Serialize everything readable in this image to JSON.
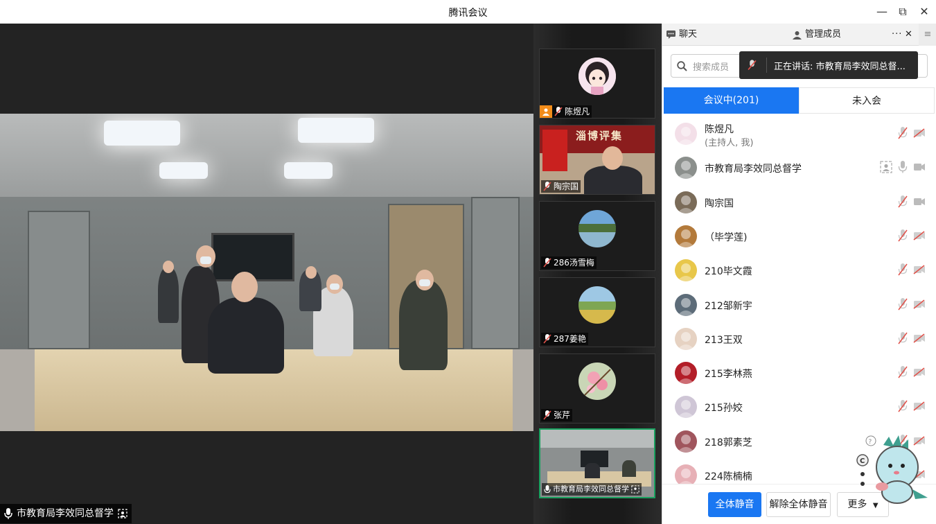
{
  "window": {
    "title": "腾讯会议",
    "minimize_glyph": "—",
    "restore_glyph": "⧉",
    "close_glyph": "✕"
  },
  "main_video": {
    "speaker_name": "市教育局李效同总督学"
  },
  "thumbnails": [
    {
      "name": "陈煜凡",
      "is_host": true
    },
    {
      "name": "陶宗国",
      "is_host": false,
      "banner_text": "淄博评集"
    },
    {
      "name": "286汤雪梅",
      "is_host": false
    },
    {
      "name": "287姜艳",
      "is_host": false
    },
    {
      "name": "张芹",
      "is_host": false
    },
    {
      "name": "市教育局李效同总督学",
      "is_host": false,
      "active": true
    }
  ],
  "panel": {
    "tab_chat": "聊天",
    "tab_manage": "管理成员",
    "more_glyph": "···",
    "close_glyph": "✕",
    "menu_glyph": "≡",
    "search_placeholder": "搜索成员",
    "speaking_toast": "正在讲话: 市教育局李效同总督...",
    "seg_in_meeting": "会议中(201)",
    "seg_not_joined": "未入会",
    "members": [
      {
        "name": "陈煜凡",
        "sub": "(主持人, 我)",
        "mic": "muted",
        "cam": "off"
      },
      {
        "name": "市教育局李效同总督学",
        "sub": "",
        "mic": "on",
        "cam": "on",
        "screen": true
      },
      {
        "name": "陶宗国",
        "sub": "",
        "mic": "muted",
        "cam": "on"
      },
      {
        "name": "（毕学莲)",
        "sub": "",
        "mic": "muted",
        "cam": "off"
      },
      {
        "name": "210毕文霞",
        "sub": "",
        "mic": "muted",
        "cam": "off"
      },
      {
        "name": "212邹新宇",
        "sub": "",
        "mic": "muted",
        "cam": "off"
      },
      {
        "name": "213王双",
        "sub": "",
        "mic": "muted",
        "cam": "off"
      },
      {
        "name": "215李林燕",
        "sub": "",
        "mic": "muted",
        "cam": "off"
      },
      {
        "name": "215孙姣",
        "sub": "",
        "mic": "muted",
        "cam": "off"
      },
      {
        "name": "218郭素芝",
        "sub": "",
        "mic": "muted",
        "cam": "off"
      },
      {
        "name": "224陈楠楠",
        "sub": "",
        "mic": "muted",
        "cam": "off"
      }
    ],
    "btn_mute_all": "全体静音",
    "btn_unmute_all": "解除全体静音",
    "btn_more": "更多"
  },
  "colors": {
    "accent": "#1a77f2",
    "host_badge": "#f28c1a",
    "muted_red": "#e0524b",
    "active_border": "#19a15f"
  }
}
